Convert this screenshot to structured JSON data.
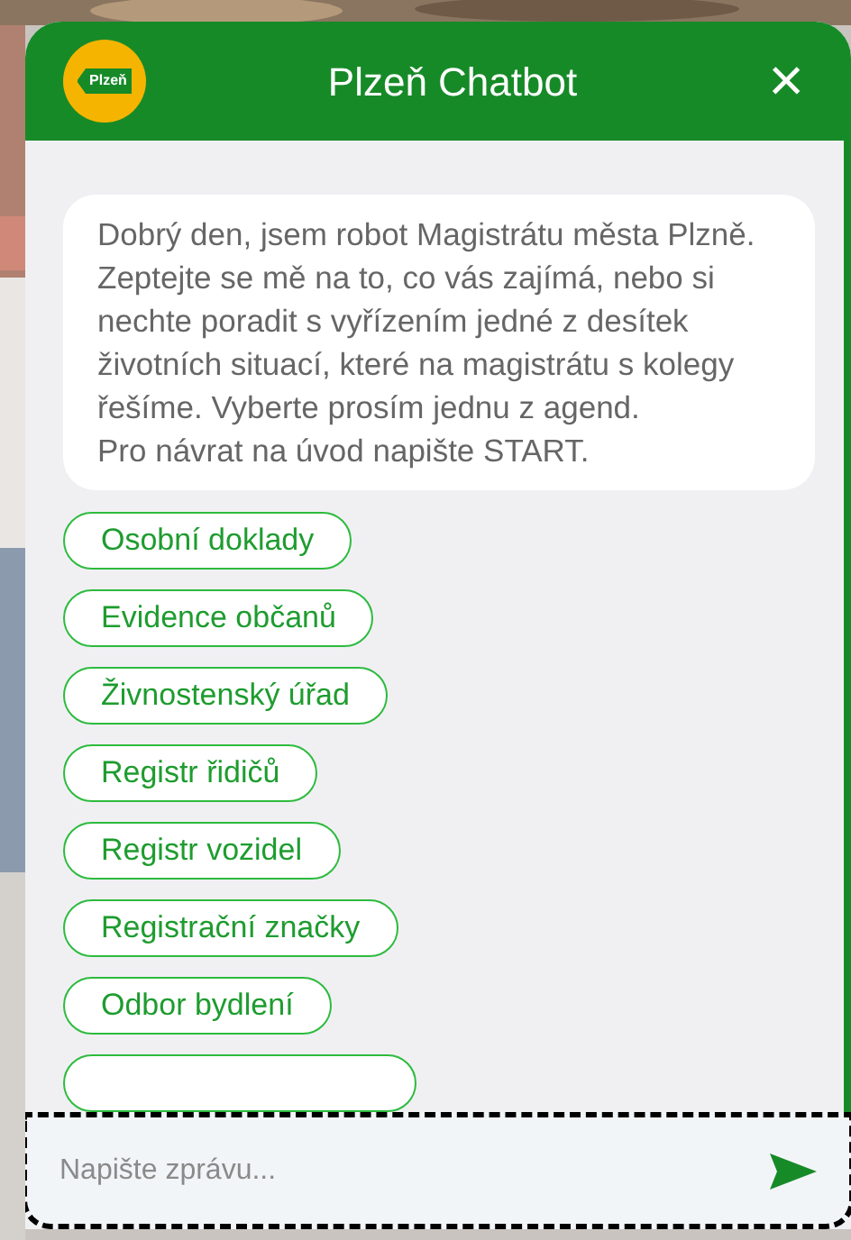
{
  "header": {
    "logo_text": "Plzeň",
    "title": "Plzeň Chatbot",
    "close": "×"
  },
  "message": "Dobrý den, jsem robot Magistrátu města Plzně.\nZeptejte se mě na to, co vás zajímá, nebo si nechte poradit s vyřízením jedné z desítek životních situací, které na magistrátu s kolegy řešíme. Vyberte prosím jednu z agend.\nPro návrat na úvod napište START.",
  "options": [
    {
      "label": "Osobní doklady"
    },
    {
      "label": "Evidence občanů"
    },
    {
      "label": "Živnostenský úřad"
    },
    {
      "label": "Registr řidičů"
    },
    {
      "label": "Registr vozidel"
    },
    {
      "label": "Registrační značky"
    },
    {
      "label": "Odbor bydlení"
    }
  ],
  "covered_option": true,
  "input": {
    "placeholder": "Napište zprávu..."
  }
}
